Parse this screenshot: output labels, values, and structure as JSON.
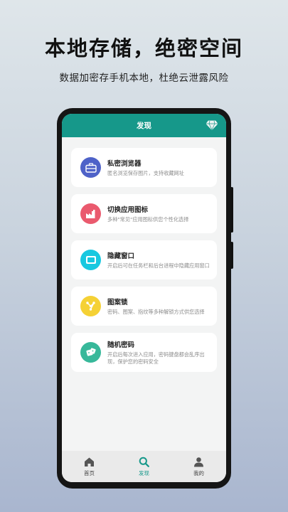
{
  "promo": {
    "headline": "本地存储，绝密空间",
    "subline": "数据加密存手机本地，杜绝云泄露风险"
  },
  "appbar": {
    "title": "发现",
    "right_icon": "diamond-icon"
  },
  "features": [
    {
      "title": "私密浏览器",
      "desc": "匿名浏览保存图片，支持收藏网址",
      "icon": "briefcase-icon",
      "color": "#4e62c8"
    },
    {
      "title": "切换应用图标",
      "desc": "多种\"常见\"应用图标供您个性化选择",
      "icon": "factory-icon",
      "color": "#ea5a6e"
    },
    {
      "title": "隐藏窗口",
      "desc": "开启后可在任务栏和后台进程中隐藏应用窗口",
      "icon": "window-icon",
      "color": "#18c8e0"
    },
    {
      "title": "图案锁",
      "desc": "密码、图案、指纹等多种解锁方式供您选择",
      "icon": "pattern-lock-icon",
      "color": "#f5d135"
    },
    {
      "title": "随机密码",
      "desc": "开启后每次进入应用，密码键盘都会乱序出现，保护您的密码安全",
      "icon": "dice-icon",
      "color": "#37b89a"
    }
  ],
  "tabs": [
    {
      "label": "首页",
      "icon": "home-icon",
      "active": false
    },
    {
      "label": "发现",
      "icon": "search-icon",
      "active": true
    },
    {
      "label": "我的",
      "icon": "user-icon",
      "active": false
    }
  ],
  "colors": {
    "accent": "#16988a",
    "screen_bg": "#f3f4f4",
    "tabbar_bg": "#eaeaea"
  }
}
